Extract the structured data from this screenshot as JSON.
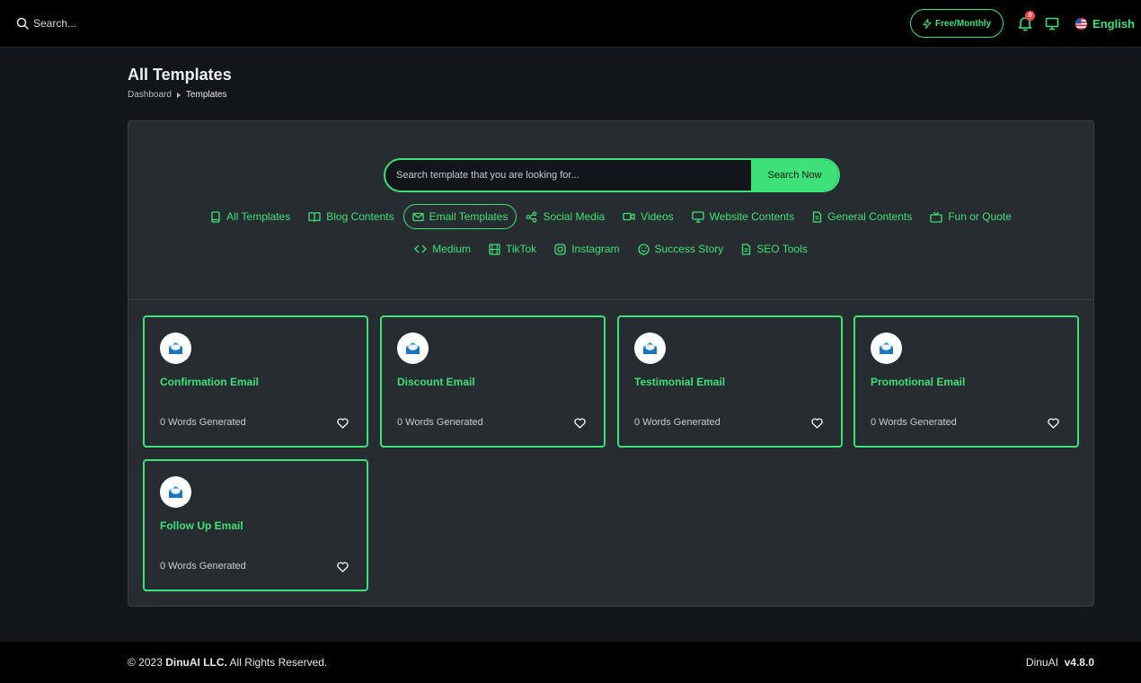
{
  "topbar": {
    "search_placeholder": "Search...",
    "plan_label": "Free/Monthly",
    "notification_count": "0",
    "language": "English"
  },
  "header": {
    "title": "All Templates",
    "breadcrumb": [
      "Dashboard",
      "Templates"
    ]
  },
  "search": {
    "placeholder": "Search template that you are looking for...",
    "button_label": "Search Now"
  },
  "categories_row1": [
    {
      "label": "All Templates",
      "icon": "book-icon",
      "active": false
    },
    {
      "label": "Blog Contents",
      "icon": "open-book-icon",
      "active": false
    },
    {
      "label": "Email Templates",
      "icon": "mail-icon",
      "active": true
    },
    {
      "label": "Social Media",
      "icon": "share-icon",
      "active": false
    },
    {
      "label": "Videos",
      "icon": "video-icon",
      "active": false
    },
    {
      "label": "Website Contents",
      "icon": "monitor-icon",
      "active": false
    },
    {
      "label": "General Contents",
      "icon": "document-icon",
      "active": false
    },
    {
      "label": "Fun or Quote",
      "icon": "tv-icon",
      "active": false
    }
  ],
  "categories_row2": [
    {
      "label": "Medium",
      "icon": "code-icon",
      "active": false
    },
    {
      "label": "TikTok",
      "icon": "film-icon",
      "active": false
    },
    {
      "label": "Instagram",
      "icon": "instagram-icon",
      "active": false
    },
    {
      "label": "Success Story",
      "icon": "smile-icon",
      "active": false
    },
    {
      "label": "SEO Tools",
      "icon": "document-icon",
      "active": false
    }
  ],
  "templates": [
    {
      "title": "Confirmation Email",
      "words": "0 Words Generated"
    },
    {
      "title": "Discount Email",
      "words": "0 Words Generated"
    },
    {
      "title": "Testimonial Email",
      "words": "0 Words Generated"
    },
    {
      "title": "Promotional Email",
      "words": "0 Words Generated"
    },
    {
      "title": "Follow Up Email",
      "words": "0 Words Generated"
    }
  ],
  "footer": {
    "copyright_prefix": "© 2023 ",
    "company": "DinuAI LLC.",
    "copyright_suffix": " All Rights Reserved.",
    "product": "DinuAI",
    "version": "v4.8.0"
  },
  "colors": {
    "accent": "#3ee07a",
    "background": "#12161b",
    "panel": "#272c30",
    "topbar": "#000000",
    "badge": "#ef4b4b",
    "mail_icon": "#2a8fd8"
  }
}
